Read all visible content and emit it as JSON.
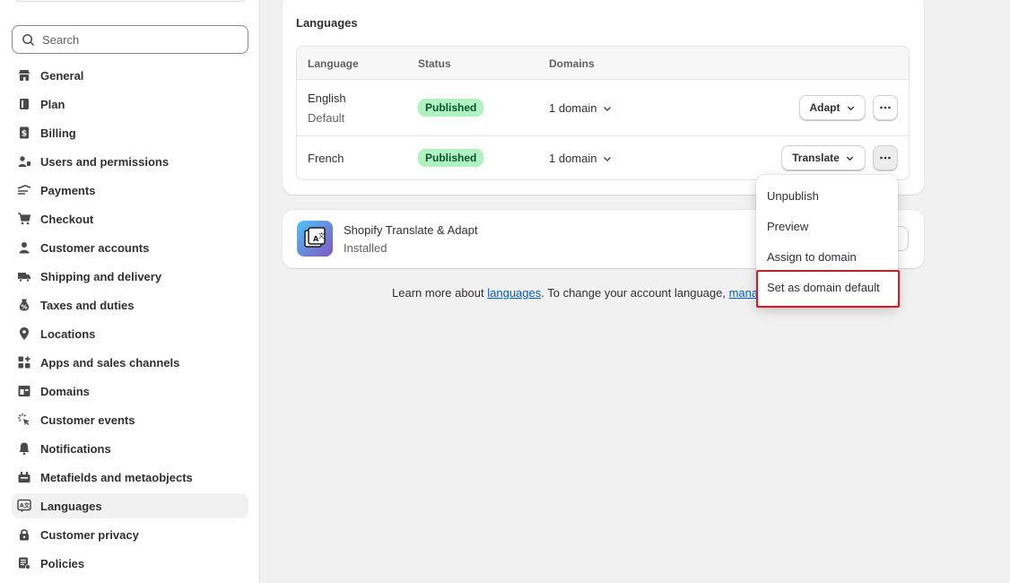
{
  "sidebar": {
    "search_placeholder": "Search",
    "items": [
      {
        "label": "General",
        "icon": "store-icon"
      },
      {
        "label": "Plan",
        "icon": "plan-icon"
      },
      {
        "label": "Billing",
        "icon": "billing-icon"
      },
      {
        "label": "Users and permissions",
        "icon": "users-icon"
      },
      {
        "label": "Payments",
        "icon": "payments-icon"
      },
      {
        "label": "Checkout",
        "icon": "cart-icon"
      },
      {
        "label": "Customer accounts",
        "icon": "person-icon"
      },
      {
        "label": "Shipping and delivery",
        "icon": "truck-icon"
      },
      {
        "label": "Taxes and duties",
        "icon": "tax-icon"
      },
      {
        "label": "Locations",
        "icon": "location-icon"
      },
      {
        "label": "Apps and sales channels",
        "icon": "apps-icon"
      },
      {
        "label": "Domains",
        "icon": "domains-icon"
      },
      {
        "label": "Customer events",
        "icon": "cursor-icon"
      },
      {
        "label": "Notifications",
        "icon": "bell-icon"
      },
      {
        "label": "Metafields and metaobjects",
        "icon": "metafields-icon"
      },
      {
        "label": "Languages",
        "icon": "language-icon",
        "active": true
      },
      {
        "label": "Customer privacy",
        "icon": "lock-icon"
      },
      {
        "label": "Policies",
        "icon": "policies-icon"
      }
    ]
  },
  "languages": {
    "title": "Languages",
    "headers": {
      "language": "Language",
      "status": "Status",
      "domains": "Domains"
    },
    "rows": [
      {
        "name": "English",
        "sub": "Default",
        "status": "Published",
        "domain": "1 domain",
        "action": "Adapt"
      },
      {
        "name": "French",
        "status": "Published",
        "domain": "1 domain",
        "action": "Translate"
      }
    ]
  },
  "app": {
    "title": "Shopify Translate & Adapt",
    "status": "Installed"
  },
  "footer": {
    "prefix": "Learn more about ",
    "link1": "languages",
    "middle": ". To change your account language, ",
    "link2": "manage"
  },
  "menu": {
    "items": [
      "Unpublish",
      "Preview",
      "Assign to domain",
      "Set as domain default"
    ]
  },
  "colors": {
    "badge_bg": "#aff2c0",
    "badge_text": "#0c5132",
    "highlight": "#e0161e",
    "link": "#005bd3"
  }
}
